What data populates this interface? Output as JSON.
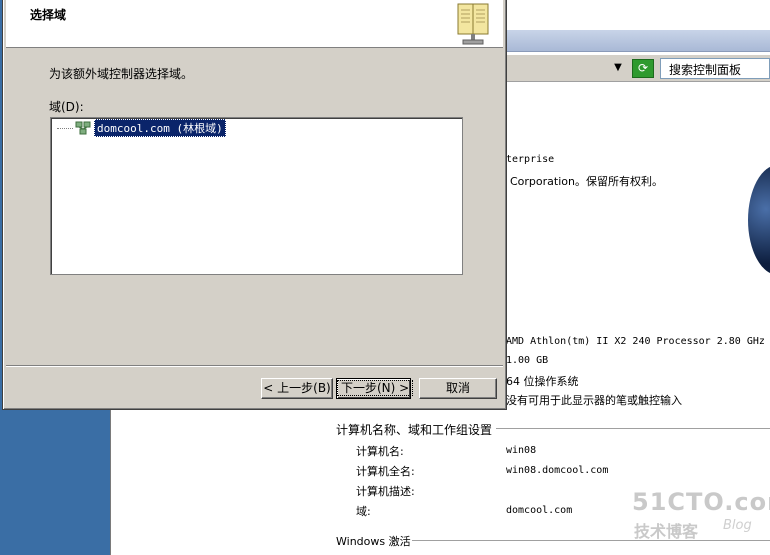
{
  "wizard": {
    "title": "选择域",
    "description": "为该额外域控制器选择域。",
    "domain_label": "域(D):",
    "tree_items": [
      {
        "label": "domcool.com (林根域)"
      }
    ],
    "buttons": {
      "back": "< 上一步(B)",
      "next": "下一步(N) >",
      "cancel": "取消"
    }
  },
  "background": {
    "search_placeholder": "搜索控制面板",
    "edition_fragment": "terprise",
    "copyright_fragment": "Corporation。保留所有权利。",
    "processor_fragment": "AMD Athlon(tm) II X2 240 Processor   2.80 GHz",
    "memory_fragment": "1.00 GB",
    "system_type_fragment": "64 位操作系统",
    "pen_fragment": "没有可用于此显示器的笔或触控输入",
    "computer_section_title": "计算机名称、域和工作组设置",
    "computer_rows": [
      {
        "label": "计算机名:",
        "value": "win08"
      },
      {
        "label": "计算机全名:",
        "value": "win08.domcool.com"
      },
      {
        "label": "计算机描述:",
        "value": ""
      },
      {
        "label": "域:",
        "value": "domcool.com"
      }
    ],
    "activation_section_title": "Windows 激活"
  },
  "watermark": {
    "main": "51CTO.com",
    "sub": "技术博客",
    "blog": "Blog"
  },
  "colors": {
    "desktop": "#3a6ea5",
    "dialog_face": "#d4d0c8",
    "selection": "#0a246a"
  }
}
